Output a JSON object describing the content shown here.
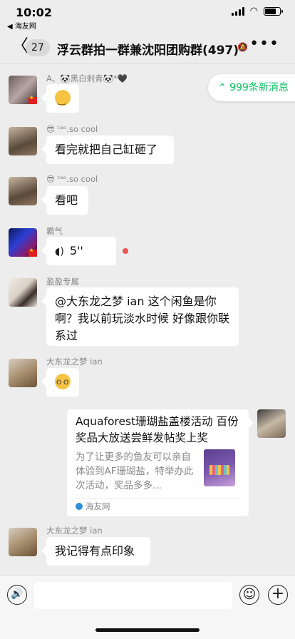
{
  "status_bar": {
    "time": "10:02",
    "location_arrow": "➚",
    "back_app": "◀ 海友网",
    "battery_level": 0.75
  },
  "navbar": {
    "back_glyph": "〈",
    "unread_badge": "27",
    "title": "浮云群拍一群兼沈阳团购群(497)",
    "mute_icon": "🔕",
    "more_glyph": "•••"
  },
  "new_messages": "⌃ 999条新消息",
  "messages": [
    {
      "sender": "A、🐼黑白刺青🐼*🖤",
      "type": "emoji"
    },
    {
      "sender": "😎 ᵗᵃᵒ.so cool",
      "text": "看完就把自己缸砸了"
    },
    {
      "sender": "😎 ᵗᵃᵒ.so cool",
      "text": "看吧"
    },
    {
      "sender": "霸气",
      "voice_duration": "5''"
    },
    {
      "sender": "盈盈专属",
      "text": "@大东龙之梦 ian 这个闲鱼是你啊？我以前玩淡水时候 好像跟你联系过"
    },
    {
      "sender": "大东龙之梦 ian",
      "type": "emoji"
    },
    {
      "sender": "大东龙之梦 ian",
      "text": "我记得有点印象"
    }
  ],
  "link_card": {
    "title": "Aquaforest珊瑚盐盖楼活动 百份奖品大放送尝鲜发帖奖上奖",
    "description": "为了让更多的鱼友可以亲自体验到AF珊瑚盐，特举办此次活动，奖品多多...",
    "source": "海友网"
  },
  "input_bar": {
    "voice_icon": "🔊",
    "emoji_icon": "☺",
    "plus_icon": "+",
    "placeholder": ""
  },
  "colors": {
    "background": "#ededed",
    "accent_green": "#07c160",
    "bubble": "#ffffff",
    "unread_dot": "#f05050"
  }
}
